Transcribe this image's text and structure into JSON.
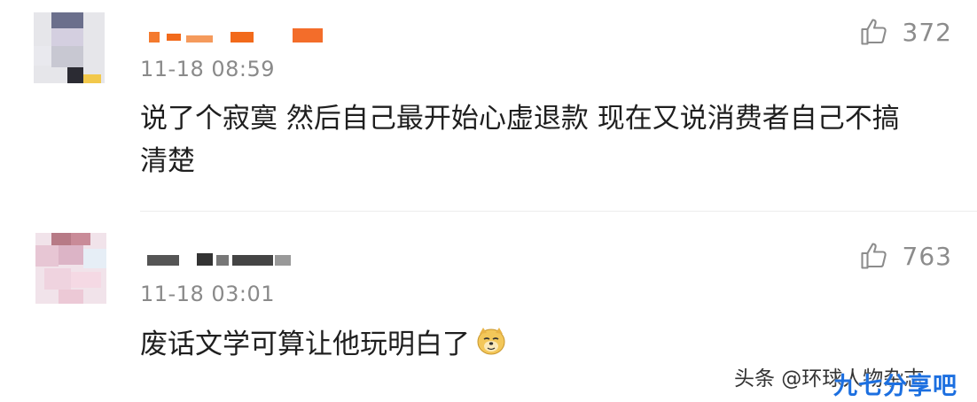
{
  "comments": [
    {
      "time": "11-18 08:59",
      "text": "说了个寂寞 然后自己最开始心虚退款 现在又说消费者自己不搞清楚",
      "likes": "372"
    },
    {
      "time": "11-18 03:01",
      "text": "废话文学可算让他玩明白了",
      "likes": "763",
      "emoji": "doge-emoji"
    }
  ],
  "watermark": "头条 @环球人物杂志",
  "brand": "九七分享吧",
  "colors": {
    "brand": "#1c6fe0",
    "meta_gray": "#8a8a8a",
    "name_orange": "#f26a1b"
  },
  "icons": {
    "like": "thumbs-up-icon"
  }
}
